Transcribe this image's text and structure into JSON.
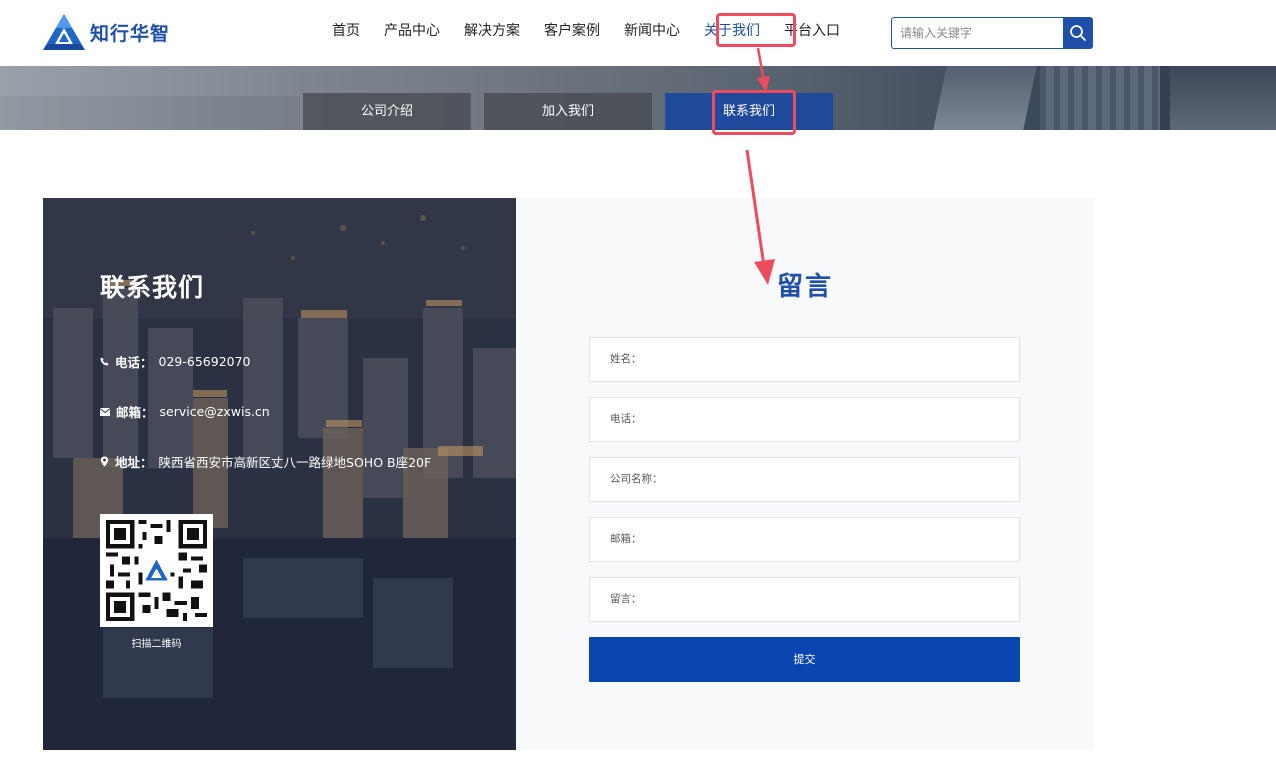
{
  "header": {
    "logo_text": "知行华智",
    "nav": [
      {
        "label": "首页"
      },
      {
        "label": "产品中心"
      },
      {
        "label": "解决方案"
      },
      {
        "label": "客户案例"
      },
      {
        "label": "新闻中心"
      },
      {
        "label": "关于我们",
        "active": true
      },
      {
        "label": "平台入口"
      }
    ],
    "search": {
      "placeholder": "请输入关键字",
      "value": ""
    }
  },
  "subnav": [
    {
      "label": "公司介绍"
    },
    {
      "label": "加入我们"
    },
    {
      "label": "联系我们",
      "active": true
    }
  ],
  "contact": {
    "title": "联系我们",
    "phone": {
      "label": "电话：",
      "value": "029-65692070"
    },
    "email": {
      "label": "邮箱：",
      "value": "service@zxwis.cn"
    },
    "address": {
      "label": "地址：",
      "value": "陕西省西安市高新区丈八一路绿地SOHO B座20F"
    },
    "qr_caption": "扫描二维码"
  },
  "form": {
    "title": "留言",
    "fields": [
      {
        "label": "姓名：",
        "value": ""
      },
      {
        "label": "电话：",
        "value": ""
      },
      {
        "label": "公司名称：",
        "value": ""
      },
      {
        "label": "邮箱：",
        "value": ""
      },
      {
        "label": "留言：",
        "value": ""
      }
    ],
    "submit_label": "提交"
  },
  "colors": {
    "brand_blue": "#1f4fa8",
    "submit_blue": "#0b46b0",
    "highlight_red": "#ee4b5f",
    "subnav_active": "#1f4a9c"
  },
  "icons": [
    "logo-icon",
    "search-icon",
    "phone-icon",
    "mail-icon",
    "location-icon",
    "qr-code"
  ]
}
